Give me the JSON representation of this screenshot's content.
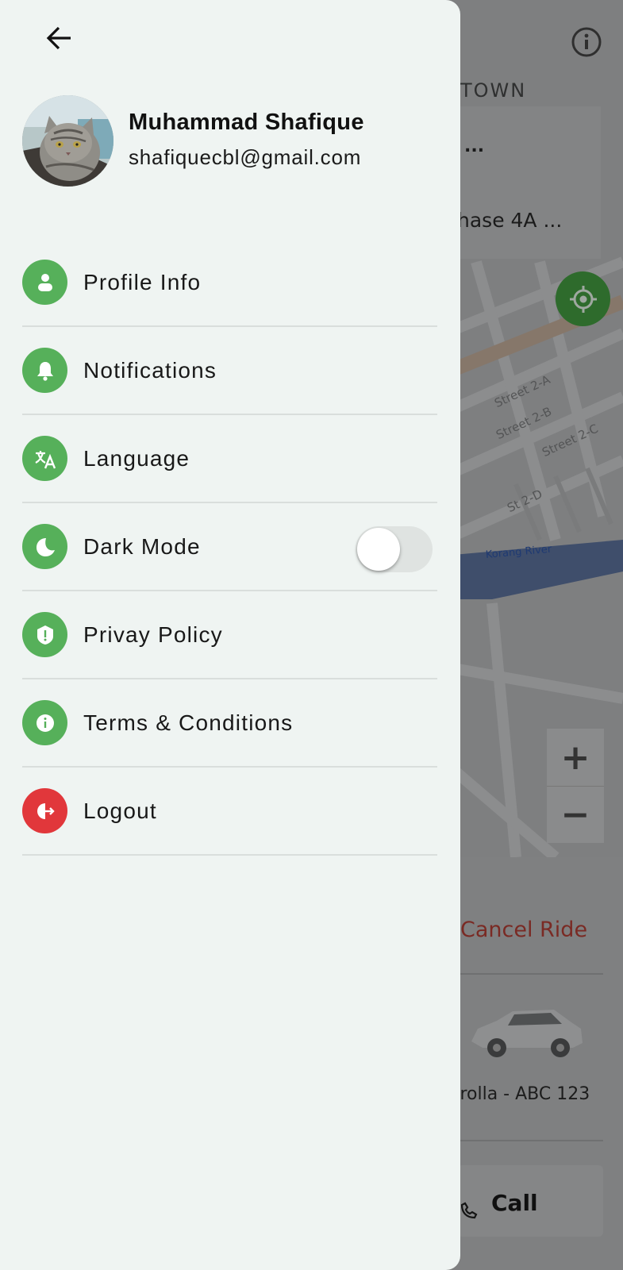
{
  "drawer": {
    "user": {
      "name": "Muhammad Shafique",
      "email": "shafiquecbl@gmail.com"
    },
    "menu": [
      {
        "label": "Profile Info",
        "icon": "person-icon"
      },
      {
        "label": "Notifications",
        "icon": "bell-icon"
      },
      {
        "label": "Language",
        "icon": "translate-icon"
      },
      {
        "label": "Dark Mode",
        "icon": "moon-icon",
        "toggle": false
      },
      {
        "label": "Privay Policy",
        "icon": "shield-alert-icon"
      },
      {
        "label": "Terms & Conditions",
        "icon": "info-icon"
      },
      {
        "label": "Logout",
        "icon": "logout-icon"
      }
    ]
  },
  "background": {
    "address": {
      "town": "TOWN",
      "line1": "...",
      "line2": "hase 4A ..."
    },
    "map_labels": {
      "street_2a": "Street 2-A",
      "street_2b": "Street 2-B",
      "street_2c": "Street 2-C",
      "st_2d": "St 2-D",
      "river": "Korang River"
    },
    "zoom": {
      "in": "+",
      "out": "−"
    },
    "sheet": {
      "cancel": "Cancel Ride",
      "car_plate": "orolla - ABC 123",
      "call": "Call"
    }
  },
  "colors": {
    "accent_green": "#56b05a",
    "logout_red": "#e1373b",
    "drawer_bg": "#eff4f2"
  }
}
